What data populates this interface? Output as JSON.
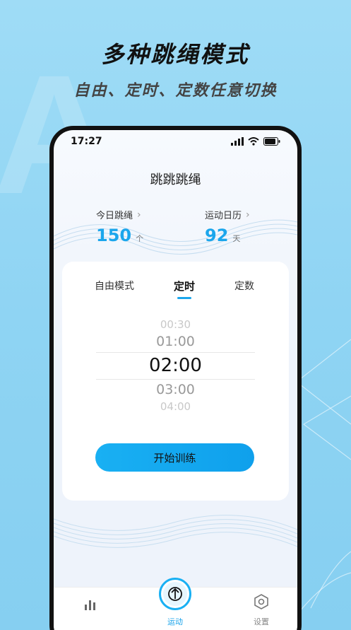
{
  "promo": {
    "title": "多种跳绳模式",
    "subtitle": "自由、定时、定数任意切换"
  },
  "status_bar": {
    "time": "17:27"
  },
  "app": {
    "title": "跳跳跳绳"
  },
  "stats": {
    "today": {
      "label": "今日跳绳",
      "value": "150",
      "unit": "个"
    },
    "calendar": {
      "label": "运动日历",
      "value": "92",
      "unit": "天"
    }
  },
  "modes": {
    "tabs": [
      {
        "label": "自由模式",
        "active": false
      },
      {
        "label": "定时",
        "active": true
      },
      {
        "label": "定数",
        "active": false
      }
    ]
  },
  "picker": {
    "options": [
      "00:30",
      "01:00",
      "02:00",
      "03:00",
      "04:00"
    ],
    "selected": "02:00"
  },
  "start_button": {
    "label": "开始训练"
  },
  "tabbar": {
    "items": [
      {
        "label": "",
        "icon": "stats-icon"
      },
      {
        "label": "运动",
        "icon": "sport-icon",
        "active": true
      },
      {
        "label": "设置",
        "icon": "settings-icon"
      }
    ]
  },
  "colors": {
    "accent": "#1ba6ec",
    "background": "#9fdcf6"
  }
}
